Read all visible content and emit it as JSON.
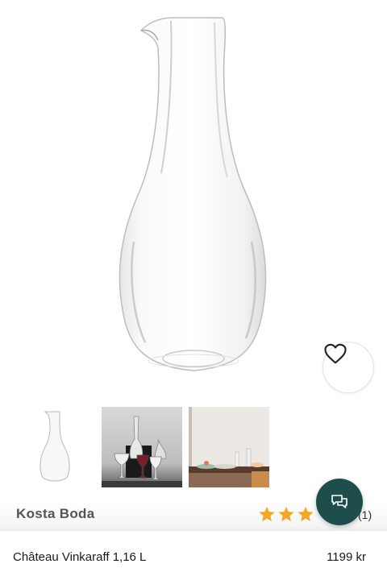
{
  "gallery": {
    "main_image": "glass-carafe-image",
    "thumbnails": [
      {
        "name": "carafe-thumbnail"
      },
      {
        "name": "glassware-set-thumbnail"
      },
      {
        "name": "table-setting-thumbnail"
      }
    ]
  },
  "favorite": {
    "icon": "heart-icon"
  },
  "chat": {
    "icon": "chat-bubbles-icon",
    "color": "#1e4e4c"
  },
  "product": {
    "brand": "Kosta Boda",
    "rating": 3,
    "rating_max": 5,
    "review_count": "(1)",
    "name": "Château Vinkaraff 1,16 L",
    "price": "1199 kr"
  },
  "colors": {
    "star": "#f5a623",
    "accent": "#1e4e4c"
  }
}
